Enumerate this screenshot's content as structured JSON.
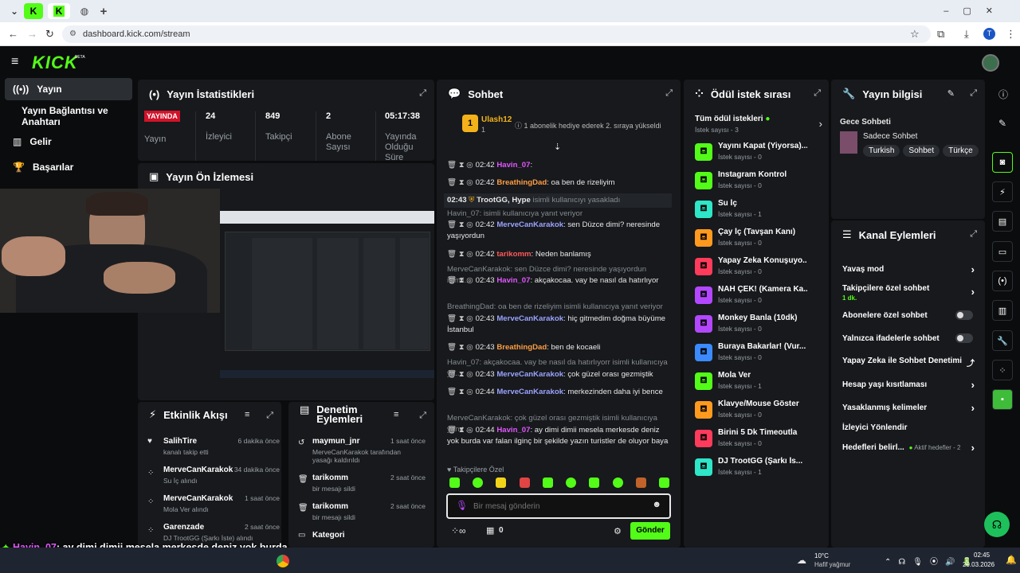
{
  "browser": {
    "url": "dashboard.kick.com/stream",
    "profile_initial": "T"
  },
  "header": {
    "logo": "KICK",
    "beta": "BETA"
  },
  "sidebar": {
    "items": [
      {
        "label": "Yayın"
      },
      {
        "label": "Yayın Bağlantısı ve Anahtarı"
      },
      {
        "label": "Gelir"
      },
      {
        "label": "Başarılar"
      }
    ]
  },
  "stats": {
    "title": "Yayın İstatistikleri",
    "live_badge": "YAYINDA",
    "live_label": "Yayın",
    "items": [
      {
        "value": "24",
        "label": "İzleyici"
      },
      {
        "value": "849",
        "label": "Takipçi"
      },
      {
        "value": "2",
        "label": "Abone Sayısı"
      },
      {
        "value": "05:17:38",
        "label": "Yayında Olduğu Süre"
      }
    ]
  },
  "preview": {
    "title": "Yayın Ön İzlemesi"
  },
  "chat": {
    "title": "Sohbet",
    "pinned_user": "Ulash12",
    "pinned_count": "1",
    "pinned_text": "1 abonelik hediye ederek 2. sıraya yükseldi",
    "lines": [
      {
        "time": "02:42",
        "user": "Havin_07",
        "text": ":"
      },
      {
        "time": "02:42",
        "user": "BreathingDad",
        "text": ": oa ben de rizeliyim"
      },
      {
        "time": "02:43",
        "user": "TrootGG, Hype",
        "text": "isimli kullanıcıyı yasakladı"
      },
      {
        "reply": "Havin_07: isimli kullanıcıya yanıt veriyor"
      },
      {
        "time": "02:42",
        "user": "MerveCanKarakok",
        "text": ": sen Düzce dimi? neresinde yaşıyordun"
      },
      {
        "time": "02:42",
        "user": "tarikomm",
        "text": ": Neden banlamış"
      },
      {
        "reply": "MerveCanKarakok: sen Düzce dimi? neresinde yaşıyordun isimli..."
      },
      {
        "time": "02:43",
        "user": "Havin_07",
        "text": ": akçakocaa. vay be nasıl da hatırlıyor"
      },
      {
        "reply": "BreathingDad: oa ben de rizeliyim isimli kullanıcıya yanıt veriyor"
      },
      {
        "time": "02:43",
        "user": "MerveCanKarakok",
        "text": ": hiç gitmedim doğma büyüme İstanbul"
      },
      {
        "time": "02:43",
        "user": "BreathingDad",
        "text": ": ben de kocaeli"
      },
      {
        "reply": "Havin_07: akçakocaa. vay be nasıl da hatırlıyorr isimli kullanıcıya ya..."
      },
      {
        "time": "02:43",
        "user": "MerveCanKarakok",
        "text": ": çok güzel orası gezmiştik"
      },
      {
        "time": "02:44",
        "user": "MerveCanKarakok",
        "text": ": merkezinden daha iyi bence"
      },
      {
        "reply": "MerveCanKarakok: çok güzel orası gezmiştik isimli kullanıcıya yanıt ..."
      },
      {
        "time": "02:44",
        "user": "Havin_07",
        "text": ": ay dimi dimii mesela merkesde deniz yok burda var falan ilginç bir şekilde yazın turistler de oluyor baya"
      }
    ],
    "emote_label": "Takipçilere Özel",
    "input_placeholder": "Bir mesaj gönderin",
    "points": "0",
    "send": "Gönder"
  },
  "rewards": {
    "title": "Ödül istek sırası",
    "all": "Tüm ödül istekleri",
    "all_count": "İstek sayısı - 3",
    "items": [
      {
        "name": "Yayını Kapat (Yiyorsa)...",
        "count": "İstek sayısı - 0",
        "color": "#53fc18"
      },
      {
        "name": "Instagram Kontrol",
        "count": "İstek sayısı - 0",
        "color": "#53fc18"
      },
      {
        "name": "Su İç",
        "count": "İstek sayısı - 1",
        "color": "#2ee6c8"
      },
      {
        "name": "Çay İç (Tavşan Kanı)",
        "count": "İstek sayısı - 0",
        "color": "#ff9a1f"
      },
      {
        "name": "Yapay Zeka Konuşuyo...",
        "count": "İstek sayısı - 0",
        "color": "#ff3b5c"
      },
      {
        "name": "NAH ÇEK! (Kamera Ka...",
        "count": "İstek sayısı - 0",
        "color": "#b347ff"
      },
      {
        "name": "Monkey Banla (10dk)",
        "count": "İstek sayısı - 0",
        "color": "#b347ff"
      },
      {
        "name": "Buraya Bakarlar! (Vur...",
        "count": "İstek sayısı - 0",
        "color": "#3b8bff"
      },
      {
        "name": "Mola Ver",
        "count": "İstek sayısı - 1",
        "color": "#53fc18"
      },
      {
        "name": "Klavye/Mouse Göster",
        "count": "İstek sayısı - 0",
        "color": "#ff9a1f"
      },
      {
        "name": "Birini 5 Dk Timeoutla",
        "count": "İstek sayısı - 0",
        "color": "#ff3b5c"
      },
      {
        "name": "DJ TrootGG (Şarkı İs...",
        "count": "İstek sayısı - 1",
        "color": "#2ee6c8"
      }
    ]
  },
  "info": {
    "title": "Yayın bilgisi",
    "stream_title": "Gece Sohbeti",
    "category": "Sadece Sohbet",
    "tags": [
      "Turkish",
      "Sohbet",
      "Türkçe"
    ]
  },
  "channel": {
    "title": "Kanal Eylemleri",
    "items": [
      {
        "label": "Yavaş mod"
      },
      {
        "label": "Takipçilere özel sohbet",
        "sub": "1 dk."
      },
      {
        "label": "Abonelere özel sohbet"
      },
      {
        "label": "Yalnızca ifadelerle sohbet"
      },
      {
        "label": "Yapay Zeka ile Sohbet Denetimi"
      },
      {
        "label": "Hesap yaşı kısıtlaması"
      },
      {
        "label": "Yasaklanmış kelimeler"
      },
      {
        "label": "İzleyici Yönlendir"
      },
      {
        "label": "Hedefleri belirl...",
        "sub": "Aktif hedefler - 2"
      }
    ]
  },
  "activity": {
    "title": "Etkinlik Akışı",
    "items": [
      {
        "name": "SalihTire",
        "time": "6 dakika önce",
        "desc": "kanalı takip etti"
      },
      {
        "name": "MerveCanKarakok",
        "time": "34 dakika önce",
        "desc": "Su İç  alındı"
      },
      {
        "name": "MerveCanKarakok",
        "time": "1 saat önce",
        "desc": "Mola Ver alındı"
      },
      {
        "name": "Garenzade",
        "time": "2 saat önce",
        "desc": "DJ TrootGG (Şarkı İste) alındı"
      }
    ]
  },
  "mod": {
    "title": "Denetim Eylemleri",
    "items": [
      {
        "name": "maymun_jnr",
        "time": "1 saat önce",
        "desc": "MerveCanKarakok tarafından yasağı kaldırıldı"
      },
      {
        "name": "tarikomm",
        "time": "2 saat önce",
        "desc": "bir mesajı sildi"
      },
      {
        "name": "tarikomm",
        "time": "2 saat önce",
        "desc": "bir mesajı sildi"
      },
      {
        "name": "Kategori",
        "time": "",
        "desc": ""
      }
    ]
  },
  "overlay": {
    "user": "Havin_07",
    "text": ": ay dimi dimii mesela merkesde deniz yok burda var falan ilginç bir şekilde yazın turistler de oluyor baya"
  },
  "taskbar": {
    "weather_temp": "10°C",
    "weather_desc": "Hafif yağmur",
    "time": "02:45",
    "date": "29.03.2026"
  }
}
